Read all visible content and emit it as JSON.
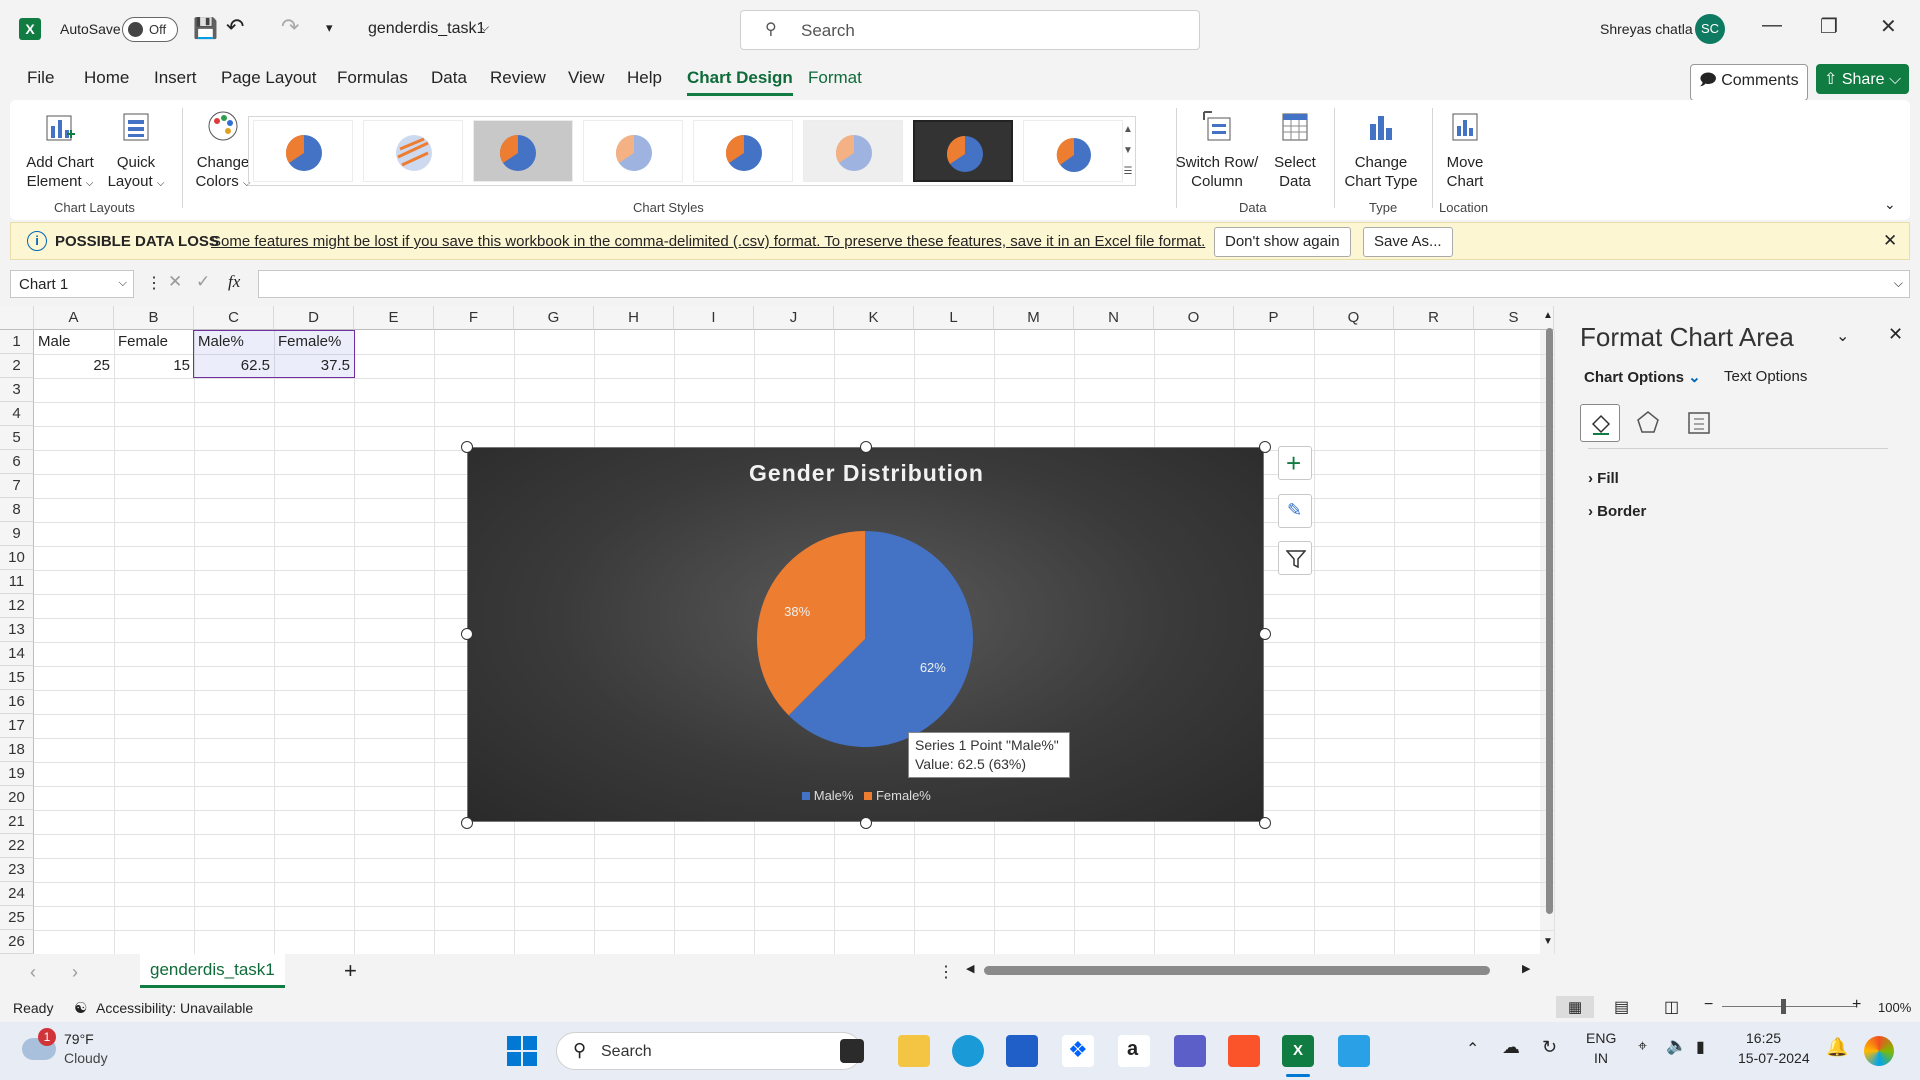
{
  "app": {
    "autosave_label": "AutoSave",
    "autosave_state": "Off",
    "file_name": "genderdis_task1",
    "search_placeholder": "Search",
    "user_name": "Shreyas chatla",
    "user_initials": "SC"
  },
  "menu": {
    "items": [
      "File",
      "Home",
      "Insert",
      "Page Layout",
      "Formulas",
      "Data",
      "Review",
      "View",
      "Help",
      "Chart Design",
      "Format"
    ],
    "active": "Chart Design",
    "comments": "Comments",
    "share": "Share"
  },
  "ribbon": {
    "add_chart_element": [
      "Add Chart",
      "Element"
    ],
    "quick_layout": [
      "Quick",
      "Layout"
    ],
    "change_colors": [
      "Change",
      "Colors"
    ],
    "switch_row_column": [
      "Switch Row/",
      "Column"
    ],
    "select_data": [
      "Select",
      "Data"
    ],
    "change_chart_type": [
      "Change",
      "Chart Type"
    ],
    "move_chart": [
      "Move",
      "Chart"
    ],
    "groups": {
      "chart_layouts": "Chart Layouts",
      "chart_styles": "Chart Styles",
      "data": "Data",
      "type": "Type",
      "location": "Location"
    }
  },
  "infobar": {
    "label": "POSSIBLE DATA LOSS",
    "message": "Some features might be lost if you save this workbook in the comma-delimited (.csv) format. To preserve these features, save it in an Excel file format.",
    "dont_show": "Don't show again",
    "save_as": "Save As..."
  },
  "formula_bar": {
    "name_box": "Chart 1",
    "fx": "fx",
    "formula": ""
  },
  "columns": [
    "A",
    "B",
    "C",
    "D",
    "E",
    "F",
    "G",
    "H",
    "I",
    "J",
    "K",
    "L",
    "M",
    "N",
    "O",
    "P",
    "Q",
    "R",
    "S"
  ],
  "rows": [
    "1",
    "2",
    "3",
    "4",
    "5",
    "6",
    "7",
    "8",
    "9",
    "10",
    "11",
    "12",
    "13",
    "14",
    "15",
    "16",
    "17",
    "18",
    "19",
    "20",
    "21",
    "22",
    "23",
    "24",
    "25",
    "26"
  ],
  "cells": {
    "A1": "Male",
    "B1": "Female",
    "C1": "Male%",
    "D1": "Female%",
    "A2": "25",
    "B2": "15",
    "C2": "62.5",
    "D2": "37.5"
  },
  "chart_data": {
    "type": "pie",
    "title": "Gender Distribution",
    "categories": [
      "Male%",
      "Female%"
    ],
    "values": [
      62.5,
      37.5
    ],
    "data_labels": [
      "62%",
      "38%"
    ],
    "colors": [
      "#4472c4",
      "#ed7d31"
    ],
    "legend": "bottom"
  },
  "tooltip": {
    "line1": "Series 1 Point \"Male%\"",
    "line2": "Value: 62.5 (63%)"
  },
  "pane": {
    "title": "Format Chart Area",
    "tab_chart": "Chart Options",
    "tab_text": "Text Options",
    "fill": "Fill",
    "border": "Border"
  },
  "sheet": {
    "tab": "genderdis_task1"
  },
  "status": {
    "ready": "Ready",
    "accessibility": "Accessibility: Unavailable",
    "zoom": "100%"
  },
  "taskbar": {
    "temp": "79°F",
    "weather": "Cloudy",
    "badge": "1",
    "search": "Search",
    "lang1": "ENG",
    "lang2": "IN",
    "time": "16:25",
    "date": "15-07-2024"
  }
}
